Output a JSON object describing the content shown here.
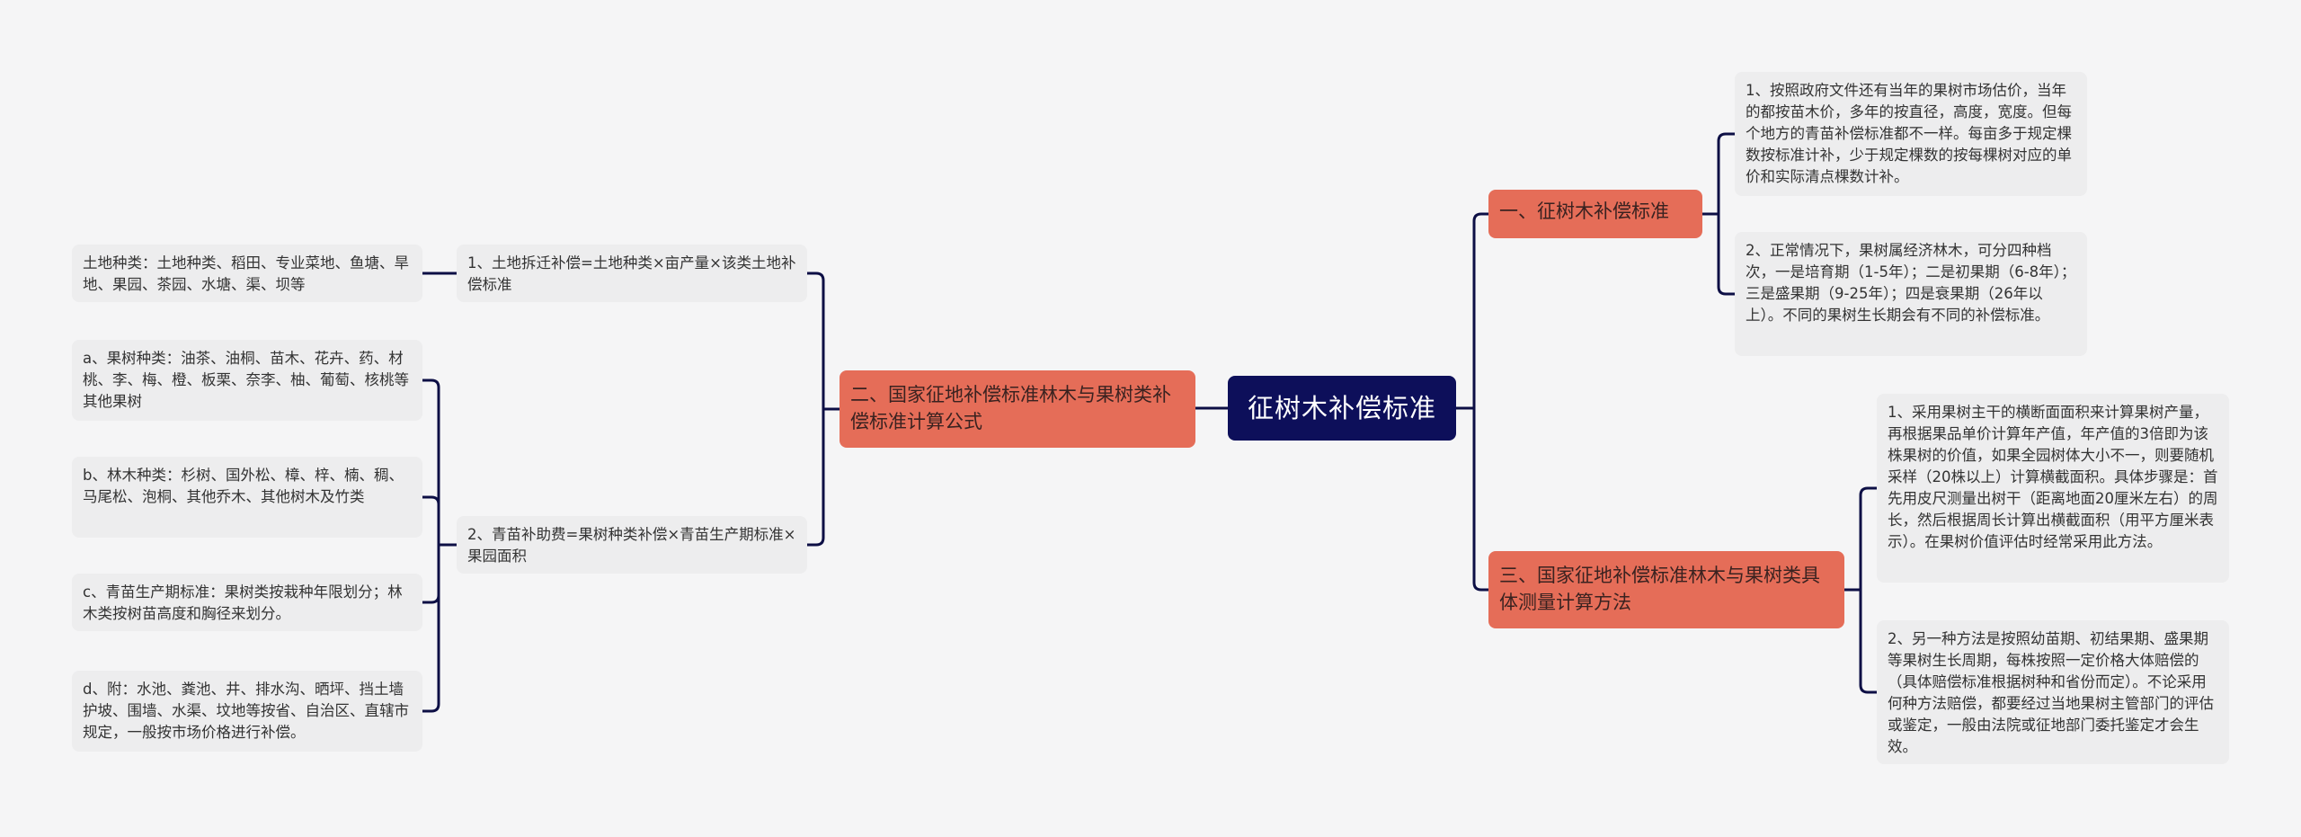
{
  "mindmap": {
    "root": {
      "label": "征树木补偿标准"
    },
    "colors": {
      "background": "#f5f5f6",
      "root_fill": "#0d0f5a",
      "branch_fill": "#e56d58",
      "leaf_fill": "#ededee",
      "connector": "#0d0f45"
    },
    "branches": [
      {
        "label": "一、征树木补偿标准",
        "side": "right",
        "children": [
          {
            "label": "1、按照政府文件还有当年的果树市场估价，当年的都按苗木价，多年的按直径，高度，宽度。但每个地方的青苗补偿标准都不一样。每亩多于规定棵数按标准计补，少于规定棵数的按每棵树对应的单价和实际清点棵数计补。"
          },
          {
            "label": "2、正常情况下，果树属经济林木，可分四种档次，一是培育期（1-5年）；二是初果期（6-8年）；三是盛果期（9-25年）；四是衰果期（26年以上）。不同的果树生长期会有不同的补偿标准。"
          }
        ]
      },
      {
        "label": "二、国家征地补偿标准林木与果树类补偿标准计算公式",
        "side": "left",
        "children": [
          {
            "label": "1、土地拆迁补偿=土地种类×亩产量×该类土地补偿标准",
            "children": [
              {
                "label": "土地种类：土地种类、稻田、专业菜地、鱼塘、旱地、果园、茶园、水塘、渠、坝等"
              }
            ]
          },
          {
            "label": "2、青苗补助费=果树种类补偿×青苗生产期标准×果园面积",
            "children": [
              {
                "label": "a、果树种类：油茶、油桐、苗木、花卉、药、材桃、李、梅、橙、板栗、奈李、柚、葡萄、核桃等其他果树"
              },
              {
                "label": "b、林木种类：杉树、国外松、樟、梓、楠、稠、马尾松、泡桐、其他乔木、其他树木及竹类"
              },
              {
                "label": "c、青苗生产期标准：果树类按栽种年限划分；林木类按树苗高度和胸径来划分。"
              },
              {
                "label": "d、附：水池、粪池、井、排水沟、晒坪、挡土墙护坡、围墙、水渠、坟地等按省、自治区、直辖市规定，一般按市场价格进行补偿。"
              }
            ]
          }
        ]
      },
      {
        "label": "三、国家征地补偿标准林木与果树类具体测量计算方法",
        "side": "right",
        "children": [
          {
            "label": "1、采用果树主干的横断面面积来计算果树产量，再根据果品单价计算年产值，年产值的3倍即为该株果树的价值，如果全园树体大小不一，则要随机采样（20株以上）计算横截面积。具体步骤是：首先用皮尺测量出树干（距离地面20厘米左右）的周长，然后根据周长计算出横截面积（用平方厘米表示）。在果树价值评估时经常采用此方法。"
          },
          {
            "label": "2、另一种方法是按照幼苗期、初结果期、盛果期等果树生长周期，每株按照一定价格大体赔偿的（具体赔偿标准根据树种和省份而定）。不论采用何种方法赔偿，都要经过当地果树主管部门的评估或鉴定，一般由法院或征地部门委托鉴定才会生效。"
          }
        ]
      }
    ]
  }
}
